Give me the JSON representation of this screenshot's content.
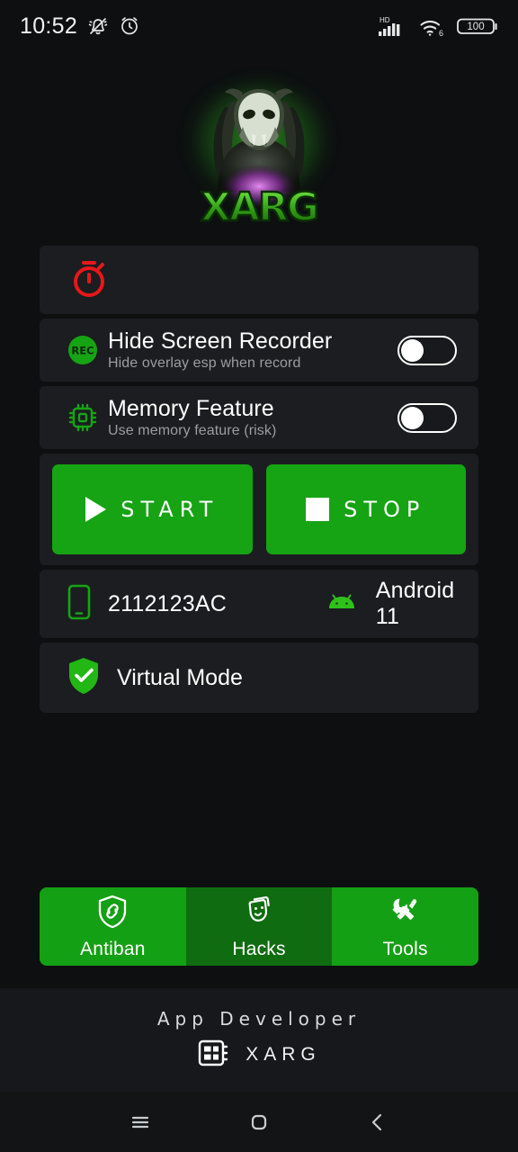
{
  "status_bar": {
    "time": "10:52",
    "icons_left": [
      "bell-off-icon",
      "alarm-clock-icon"
    ],
    "network_label": "HD",
    "wifi_label": "6",
    "battery_level": "100"
  },
  "logo": {
    "brand_text": "XARG",
    "alt": "xarg-predator-logo",
    "glow_color": "#3cdc28"
  },
  "timer_card": {
    "icon": "stopwatch-icon",
    "icon_color": "#e8171a"
  },
  "settings": [
    {
      "icon": "rec-icon",
      "icon_text": "REC",
      "title": "Hide Screen Recorder",
      "subtitle": "Hide overlay esp when record",
      "toggle_state": "off"
    },
    {
      "icon": "memory-chip-icon",
      "title": "Memory Feature",
      "subtitle": "Use memory feature (risk)",
      "toggle_state": "off"
    }
  ],
  "actions": {
    "start_label": "START",
    "stop_label": "STOP",
    "button_color": "#16a314"
  },
  "device": {
    "phone_icon": "smartphone-icon",
    "model": "2112123AC",
    "os_icon": "android-icon",
    "os_version": "Android 11",
    "virtual_mode_icon": "shield-check-icon",
    "virtual_mode_label": "Virtual Mode"
  },
  "tabs": [
    {
      "label": "Antiban",
      "icon": "shield-link-icon",
      "active": false
    },
    {
      "label": "Hacks",
      "icon": "theater-masks-icon",
      "active": true
    },
    {
      "label": "Tools",
      "icon": "wrench-screwdriver-icon",
      "active": false
    }
  ],
  "footer": {
    "title": "App Developer",
    "icon": "developer-chip-icon",
    "developer": "XARG"
  },
  "nav_bar": {
    "recents": "menu-icon",
    "home": "home-square-icon",
    "back": "chevron-left-icon"
  },
  "theme": {
    "background": "#0d0f11",
    "card": "#1b1d20",
    "accent_green": "#16a314",
    "accent_green_dark": "#106c10",
    "text_primary": "#ffffff",
    "text_secondary": "#9b9ea1"
  }
}
